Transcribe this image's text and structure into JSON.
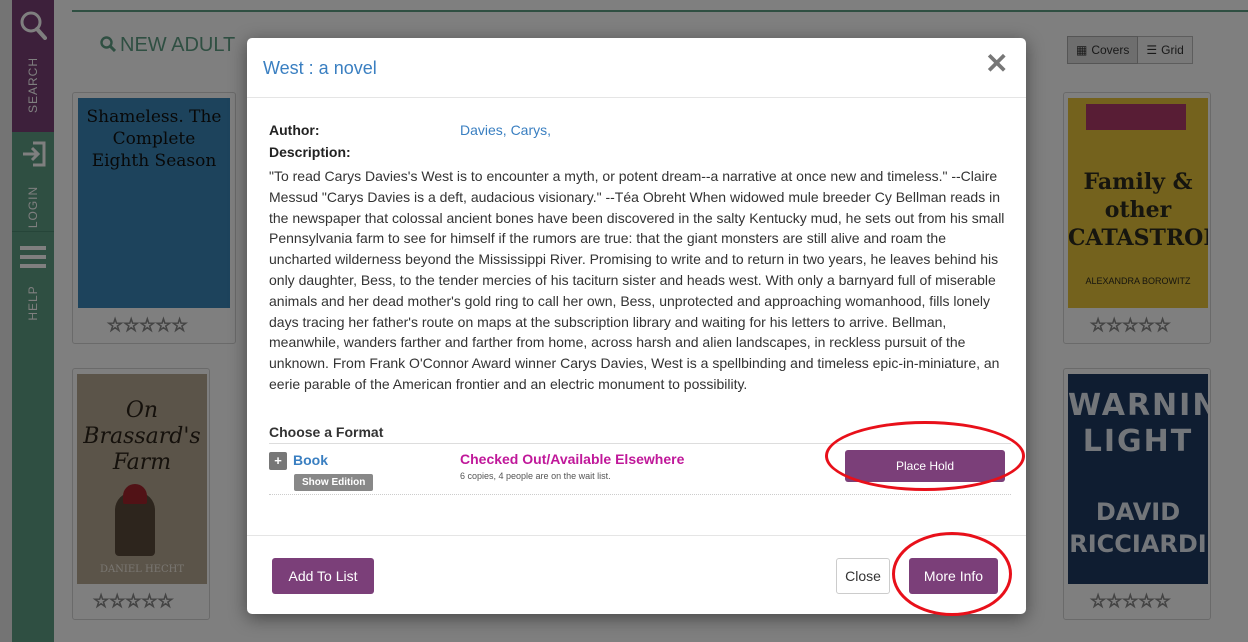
{
  "sidebar": {
    "search_label": "SEARCH",
    "login_label": "LOGIN",
    "help_label": "HELP"
  },
  "page": {
    "list_title": "NEW ADULT",
    "view_covers": "Covers",
    "view_grid": "Grid"
  },
  "books": [
    {
      "cover_text": "Shameless. The Complete Eighth Season",
      "cover_color": "#3a86b8"
    },
    {
      "cover_title": "Family & other CATASTROPHES",
      "cover_author": "ALEXANDRA BOROWITZ",
      "cover_color": "#e8c43a"
    },
    {
      "cover_title": "On Brassard's Farm",
      "cover_author": "DANIEL HECHT",
      "cover_color": "#b7a892"
    },
    {
      "cover_title": "WARNING LIGHT",
      "cover_author": "DAVID RICCIARDI",
      "cover_color": "#1f3a63"
    }
  ],
  "modal": {
    "title": "West : a novel",
    "author_label": "Author:",
    "author_value": "Davies, Carys,",
    "description_label": "Description:",
    "description": "\"To read Carys Davies's West is to encounter a myth, or potent dream--a narrative at once new and timeless.\" --Claire Messud \"Carys Davies is a deft, audacious visionary.\" --Téa Obreht When widowed mule breeder Cy Bellman reads in the newspaper that colossal ancient bones have been discovered in the salty Kentucky mud, he sets out from his small Pennsylvania farm to see for himself if the rumors are true: that the giant monsters are still alive and roam the uncharted wilderness beyond the Mississippi River. Promising to write and to return in two years, he leaves behind his only daughter, Bess, to the tender mercies of his taciturn sister and heads west. With only a barnyard full of miserable animals and her dead mother's gold ring to call her own, Bess, unprotected and approaching womanhood, fills lonely days tracing her father's route on maps at the subscription library and waiting for his letters to arrive. Bellman, meanwhile, wanders farther and farther from home, across harsh and alien landscapes, in reckless pursuit of the unknown. From Frank O'Connor Award winner Carys Davies, West is a spellbinding and timeless epic-in-miniature, an eerie parable of the American frontier and an electric monument to possibility.",
    "choose_format_label": "Choose a Format",
    "format": {
      "expand": "+",
      "name": "Book",
      "show_edition": "Show Edition",
      "status": "Checked Out/Available Elsewhere",
      "copies": "6 copies, 4 people are on the wait list.",
      "place_hold": "Place Hold"
    },
    "footer": {
      "add_to_list": "Add To List",
      "close": "Close",
      "more_info": "More Info"
    }
  },
  "colors": {
    "brand_purple": "#7b3f79",
    "brand_green": "#5f9e85",
    "link_blue": "#3a7fc1",
    "status_magenta": "#c0189a",
    "annotation_red": "#e8101a"
  }
}
